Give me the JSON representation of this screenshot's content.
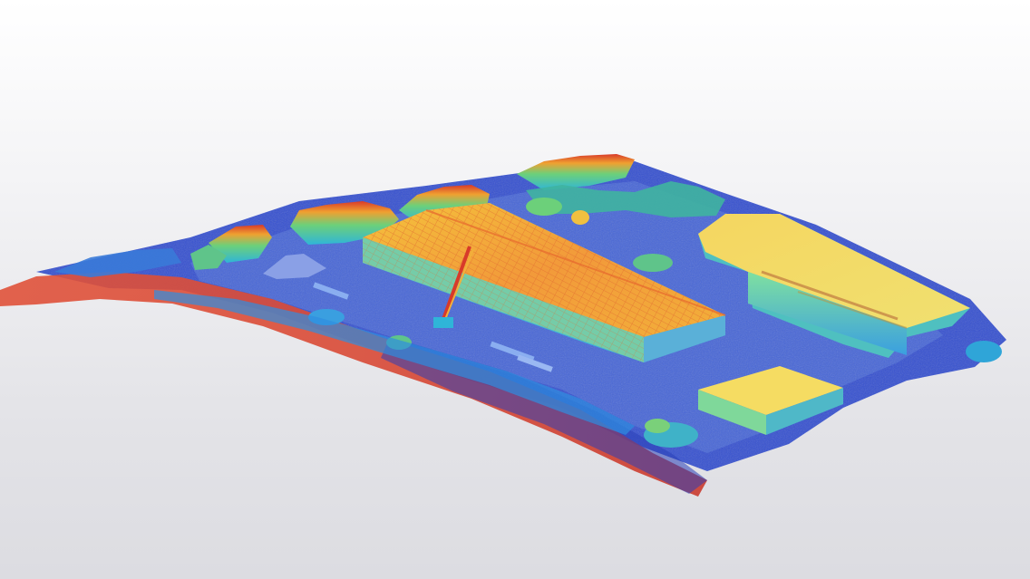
{
  "scene": {
    "description_hidden": "",
    "colormap": {
      "low": "#1b2fb0",
      "low_mid": "#3f63e0",
      "mid": "#2fb5d8",
      "mid_high": "#5fd07a",
      "high": "#f2e43c",
      "higher": "#f29a2e",
      "top": "#d83a2a"
    },
    "background": {
      "top": "#ffffff",
      "bottom": "#dcdce1"
    }
  }
}
